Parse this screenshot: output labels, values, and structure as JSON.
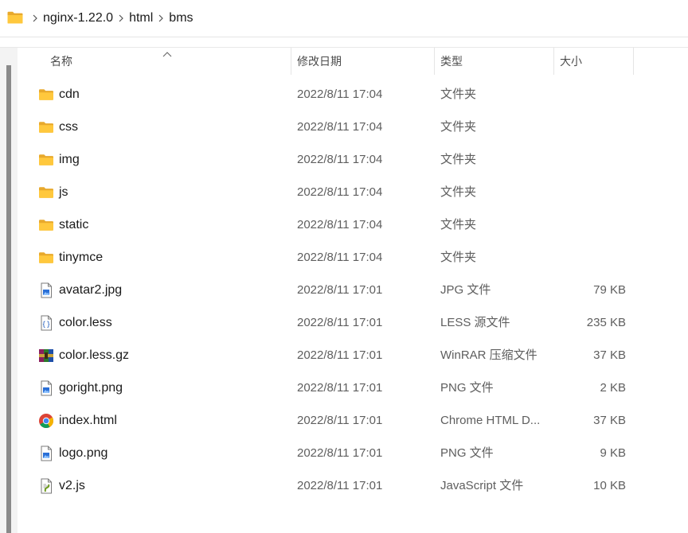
{
  "breadcrumb": [
    "nginx-1.22.0",
    "html",
    "bms"
  ],
  "columns": {
    "name": "名称",
    "date": "修改日期",
    "type": "类型",
    "size": "大小"
  },
  "files": [
    {
      "name": "cdn",
      "date": "2022/8/11 17:04",
      "type": "文件夹",
      "size": "",
      "icon": "folder-icon"
    },
    {
      "name": "css",
      "date": "2022/8/11 17:04",
      "type": "文件夹",
      "size": "",
      "icon": "folder-icon"
    },
    {
      "name": "img",
      "date": "2022/8/11 17:04",
      "type": "文件夹",
      "size": "",
      "icon": "folder-icon"
    },
    {
      "name": "js",
      "date": "2022/8/11 17:04",
      "type": "文件夹",
      "size": "",
      "icon": "folder-icon"
    },
    {
      "name": "static",
      "date": "2022/8/11 17:04",
      "type": "文件夹",
      "size": "",
      "icon": "folder-icon"
    },
    {
      "name": "tinymce",
      "date": "2022/8/11 17:04",
      "type": "文件夹",
      "size": "",
      "icon": "folder-icon"
    },
    {
      "name": "avatar2.jpg",
      "date": "2022/8/11 17:01",
      "type": "JPG 文件",
      "size": "79 KB",
      "icon": "image-file-icon"
    },
    {
      "name": "color.less",
      "date": "2022/8/11 17:01",
      "type": "LESS 源文件",
      "size": "235 KB",
      "icon": "source-file-icon"
    },
    {
      "name": "color.less.gz",
      "date": "2022/8/11 17:01",
      "type": "WinRAR 压缩文件",
      "size": "37 KB",
      "icon": "winrar-archive-icon"
    },
    {
      "name": "goright.png",
      "date": "2022/8/11 17:01",
      "type": "PNG 文件",
      "size": "2 KB",
      "icon": "image-file-icon"
    },
    {
      "name": "index.html",
      "date": "2022/8/11 17:01",
      "type": "Chrome HTML D...",
      "size": "37 KB",
      "icon": "chrome-icon"
    },
    {
      "name": "logo.png",
      "date": "2022/8/11 17:01",
      "type": "PNG 文件",
      "size": "9 KB",
      "icon": "image-file-icon"
    },
    {
      "name": "v2.js",
      "date": "2022/8/11 17:01",
      "type": "JavaScript 文件",
      "size": "10 KB",
      "icon": "script-file-icon"
    }
  ]
}
